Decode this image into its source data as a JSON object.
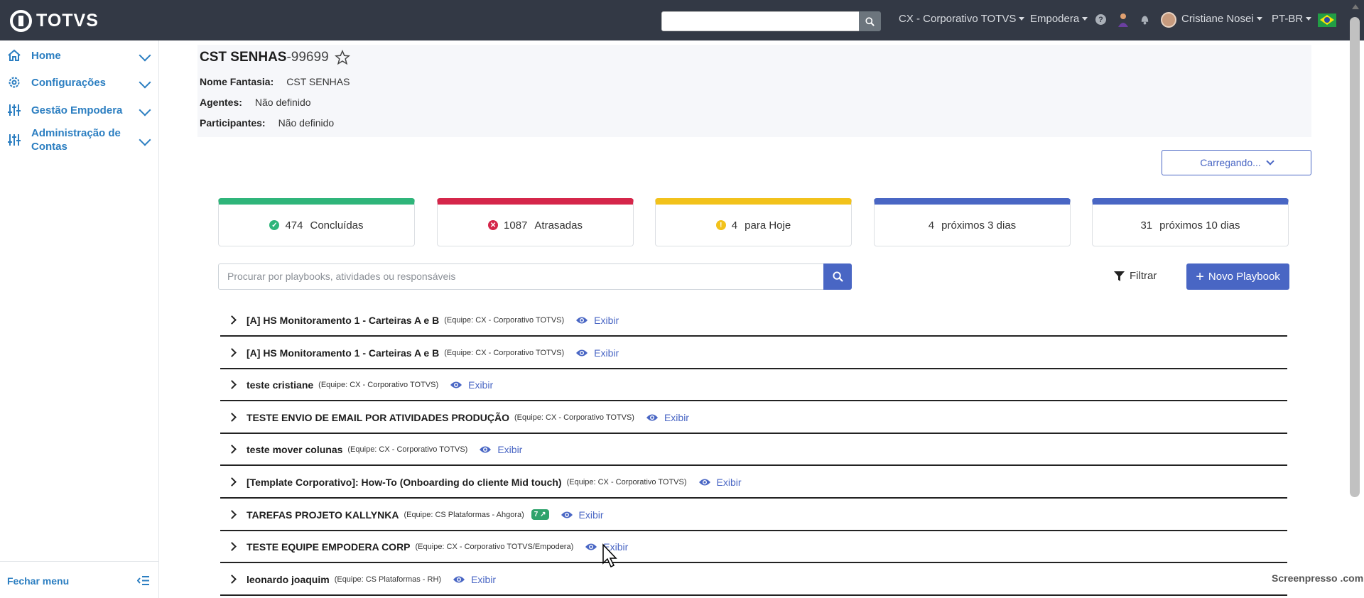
{
  "topbar": {
    "logo": "TOTVS",
    "search_value": "",
    "org_menu": "CX - Corporativo TOTVS",
    "product_menu": "Empodera",
    "user_name": "Cristiane Nosei",
    "language": "PT-BR",
    "help_glyph": "?"
  },
  "sidebar": {
    "items": [
      {
        "label": "Home",
        "icon": "home-icon"
      },
      {
        "label": "Configurações",
        "icon": "gear-icon"
      },
      {
        "label": "Gestão Empodera",
        "icon": "sliders-icon"
      },
      {
        "label": "Administração de Contas",
        "icon": "sliders-icon"
      }
    ],
    "close_label": "Fechar menu"
  },
  "header": {
    "title_bold": "CST SENHAS",
    "title_id": "-99699",
    "fields": [
      {
        "label": "Nome Fantasia:",
        "value": "CST SENHAS"
      },
      {
        "label": "Agentes:",
        "value": "Não definido"
      },
      {
        "label": "Participantes:",
        "value": "Não definido"
      }
    ]
  },
  "loading_button": "Carregando...",
  "stats": [
    {
      "count": "474",
      "label": "Concluídas",
      "color": "#2fb57a",
      "icon": "check-icon",
      "glyph": "✓"
    },
    {
      "count": "1087",
      "label": "Atrasadas",
      "color": "#d5264a",
      "icon": "x-icon",
      "glyph": "✕"
    },
    {
      "count": "4",
      "label": "para Hoje",
      "color": "#f2c21b",
      "icon": "alert-icon",
      "glyph": "!"
    },
    {
      "count": "4",
      "label": "próximos 3 dias",
      "color": "#4966c4",
      "icon": "",
      "glyph": ""
    },
    {
      "count": "31",
      "label": "próximos 10 dias",
      "color": "#4966c4",
      "icon": "",
      "glyph": ""
    }
  ],
  "list_search": {
    "placeholder": "Procurar por playbooks, atividades ou responsáveis"
  },
  "filter_label": "Filtrar",
  "new_playbook_label": "Novo Playbook",
  "view_label": "Exibir",
  "playbooks": [
    {
      "name": "[A] HS Monitoramento 1 - Carteiras A e B",
      "team": "(Equipe: CX - Corporativo TOTVS)",
      "badge": ""
    },
    {
      "name": "[A] HS Monitoramento 1 - Carteiras A e B",
      "team": "(Equipe: CX - Corporativo TOTVS)",
      "badge": ""
    },
    {
      "name": "teste cristiane",
      "team": "(Equipe: CX - Corporativo TOTVS)",
      "badge": ""
    },
    {
      "name": "TESTE ENVIO DE EMAIL POR ATIVIDADES PRODUÇÃO",
      "team": "(Equipe: CX - Corporativo TOTVS)",
      "badge": ""
    },
    {
      "name": "teste mover colunas",
      "team": "(Equipe: CX - Corporativo TOTVS)",
      "badge": ""
    },
    {
      "name": "[Template Corporativo]: How-To (Onboarding do cliente Mid touch)",
      "team": "(Equipe: CX - Corporativo TOTVS)",
      "badge": ""
    },
    {
      "name": "TAREFAS PROJETO KALLYNKA",
      "team": "(Equipe: CS Plataformas - Ahgora)",
      "badge": "7 ↗"
    },
    {
      "name": "TESTE EQUIPE EMPODERA CORP",
      "team": "(Equipe: CX - Corporativo TOTVS/Empodera)",
      "badge": ""
    },
    {
      "name": "leonardo joaquim",
      "team": "(Equipe: CS Plataformas - RH)",
      "badge": ""
    }
  ],
  "watermark": "Screenpresso .com"
}
